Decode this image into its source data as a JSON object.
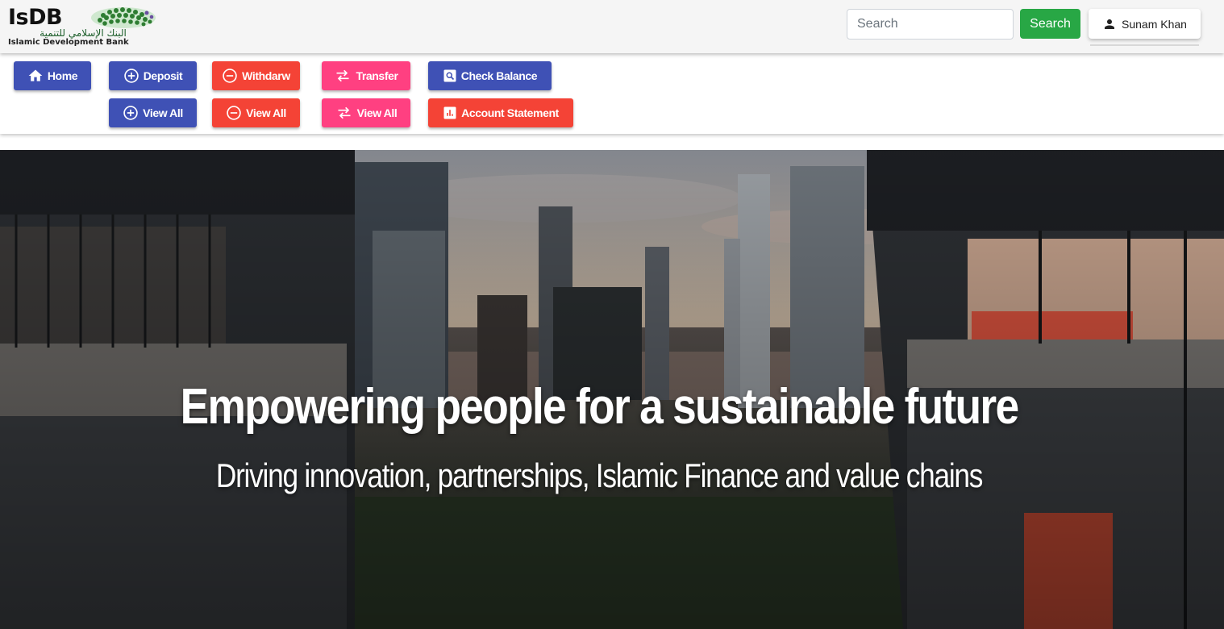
{
  "logo": {
    "abbr": "IsDB",
    "arabic": "البنك الإسلامي للتنمية",
    "english": "Islamic Development Bank"
  },
  "header": {
    "search_placeholder": "Search",
    "search_button": "Search",
    "user_name": "Sunam Khan"
  },
  "nav": {
    "row1": {
      "home": "Home",
      "deposit": "Deposit",
      "withdraw": "Withdarw",
      "transfer": "Transfer",
      "check_balance": "Check Balance"
    },
    "row2": {
      "deposit_view_all": "View All",
      "withdraw_view_all": "View All",
      "transfer_view_all": "View All",
      "account_statement": "Account Statement"
    }
  },
  "colors": {
    "primary_blue": "#3f51b5",
    "danger_red": "#f44336",
    "accent_pink": "#ff4081",
    "success_green": "#28a745"
  },
  "icons": {
    "home": "home-icon",
    "deposit": "plus-circle-icon",
    "withdraw": "minus-circle-icon",
    "transfer": "swap-arrows-icon",
    "check_balance": "search-box-icon",
    "account_statement": "bar-chart-box-icon",
    "user": "person-icon",
    "logo": "globe-dots-icon"
  },
  "hero": {
    "title": "Empowering people for a sustainable future",
    "subtitle": "Driving innovation, partnerships, Islamic Finance and value chains"
  }
}
